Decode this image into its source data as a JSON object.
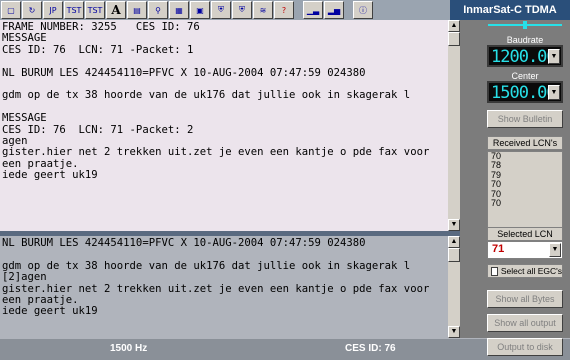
{
  "app": {
    "title": "InmarSat-C TDMA"
  },
  "toolbar": {
    "buttons": [
      {
        "name": "open-file-icon",
        "glyph": "▢"
      },
      {
        "name": "refresh-icon",
        "glyph": "↻"
      },
      {
        "name": "jp-button",
        "glyph": "JP"
      },
      {
        "name": "tst-button",
        "glyph": "TST"
      },
      {
        "name": "tst-button-2",
        "glyph": "TST"
      },
      {
        "name": "font-button",
        "glyph": "A"
      },
      {
        "name": "window-icon",
        "glyph": "▤"
      },
      {
        "name": "binoculars-icon",
        "glyph": "⚲"
      },
      {
        "name": "grid-icon",
        "glyph": "▦"
      },
      {
        "name": "device-icon",
        "glyph": "▣"
      },
      {
        "name": "shield-icon",
        "glyph": "⛨"
      },
      {
        "name": "shield-2-icon",
        "glyph": "⛨"
      },
      {
        "name": "spectrum-icon",
        "glyph": "≋"
      },
      {
        "name": "help-icon",
        "glyph": "?"
      },
      {
        "name": "level-meter-icon",
        "glyph": "▁▃"
      },
      {
        "name": "bars-icon",
        "glyph": "▂▅"
      },
      {
        "name": "info-icon",
        "glyph": "ⓘ"
      }
    ]
  },
  "top_pane": {
    "lines": [
      "FRAME NUMBER: 3255   CES ID: 76",
      "MESSAGE",
      "CES ID: 76  LCN: 71 -Packet: 1",
      "",
      "NL BURUM LES 424454110=PFVC X 10-AUG-2004 07:47:59 024380",
      "",
      "gdm op de tx 38 hoorde van de uk176 dat jullie ook in skagerak l",
      "",
      "MESSAGE",
      "CES ID: 76  LCN: 71 -Packet: 2",
      "agen",
      "gister.hier net 2 trekken uit.zet je even een kantje o pde fax voor",
      "een praatje.",
      "iede geert uk19"
    ]
  },
  "bottom_pane": {
    "lines": [
      "NL BURUM LES 424454110=PFVC X 10-AUG-2004 07:47:59 024380",
      "",
      "gdm op de tx 38 hoorde van de uk176 dat jullie ook in skagerak l",
      "[2]agen",
      "gister.hier net 2 trekken uit.zet je even een kantje o pde fax voor",
      "een praatje.",
      "iede geert uk19"
    ]
  },
  "panel": {
    "baudrate_label": "Baudrate",
    "baudrate_value": "1200.00",
    "center_label": "Center",
    "center_value": "1500.00",
    "show_bulletin": "Show Bulletin",
    "received_lcns_label": "Received LCN's",
    "received_lcns": [
      "70",
      "78",
      "79",
      "70",
      "70",
      "70"
    ],
    "selected_lcn_label": "Selected LCN",
    "selected_lcn_value": "71",
    "select_all_egcs": "Select all EGC's",
    "show_all_bytes": "Show all Bytes",
    "show_all_output": "Show all output",
    "output_to_disk": "Output to disk"
  },
  "status": {
    "frequency": "1500 Hz",
    "ces_id": "CES ID: 76"
  },
  "colors": {
    "lcd_digits": "#28e0e8",
    "title_bar": "#2a4f7a",
    "top_pane_bg": "#ece4ec",
    "bottom_pane_bg": "#b0b4bc",
    "selected_lcn": "#c00000"
  }
}
